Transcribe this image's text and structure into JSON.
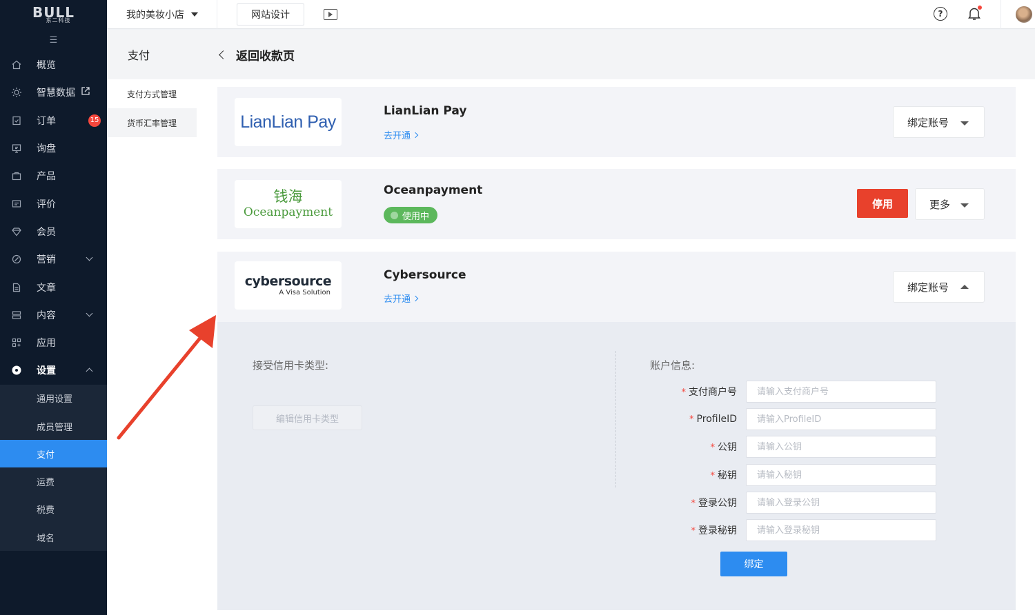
{
  "sidebar": {
    "logo_main": "BULL",
    "logo_sub": "东二科技",
    "collapse_glyph": "☰",
    "items": [
      {
        "label": "概览",
        "icon": "home-icon"
      },
      {
        "label": "智慧数据",
        "icon": "sun-icon"
      },
      {
        "label": "订单",
        "icon": "order-icon",
        "badge": "15"
      },
      {
        "label": "询盘",
        "icon": "inquiry-icon"
      },
      {
        "label": "产品",
        "icon": "product-icon"
      },
      {
        "label": "评价",
        "icon": "review-icon"
      },
      {
        "label": "会员",
        "icon": "member-icon"
      },
      {
        "label": "营销",
        "icon": "marketing-icon"
      },
      {
        "label": "文章",
        "icon": "article-icon"
      },
      {
        "label": "内容",
        "icon": "content-icon"
      },
      {
        "label": "应用",
        "icon": "apps-icon"
      },
      {
        "label": "设置",
        "icon": "settings-icon"
      }
    ],
    "settings_sub": [
      "通用设置",
      "成员管理",
      "支付",
      "运费",
      "税费",
      "域名"
    ]
  },
  "header": {
    "store_name": "我的美妆小店",
    "design_button": "网站设计",
    "help_glyph": "?"
  },
  "submenu": {
    "title": "支付",
    "items": [
      "支付方式管理",
      "货币汇率管理"
    ]
  },
  "page": {
    "back_title": "返回收款页"
  },
  "payments": [
    {
      "name": "LianLian Pay",
      "logo_text": "LianLian Pay",
      "link": "去开通",
      "action": "绑定账号"
    },
    {
      "name": "Oceanpayment",
      "logo_cn": "钱海",
      "logo_en": "Oceanpayment",
      "status": "使用中",
      "stop": "停用",
      "more": "更多"
    },
    {
      "name": "Cybersource",
      "logo_main": "cybersource",
      "logo_sub": "A Visa Solution",
      "link": "去开通",
      "action": "绑定账号"
    }
  ],
  "form": {
    "card_types_label": "接受信用卡类型:",
    "edit_card_types": "编辑信用卡类型",
    "account_info_label": "账户信息:",
    "required_mark": "*",
    "fields": [
      {
        "label": "支付商户号",
        "placeholder": "请输入支付商户号"
      },
      {
        "label": "ProfileID",
        "placeholder": "请输入ProfileID"
      },
      {
        "label": "公钥",
        "placeholder": "请输入公钥"
      },
      {
        "label": "秘钥",
        "placeholder": "请输入秘钥"
      },
      {
        "label": "登录公钥",
        "placeholder": "请输入登录公钥"
      },
      {
        "label": "登录秘钥",
        "placeholder": "请输入登录秘钥"
      }
    ],
    "bind_button": "绑定"
  },
  "colors": {
    "sidebar_bg": "#0e1a2b",
    "accent": "#2d8cf0",
    "danger": "#e8412c",
    "success": "#5cb85c"
  }
}
